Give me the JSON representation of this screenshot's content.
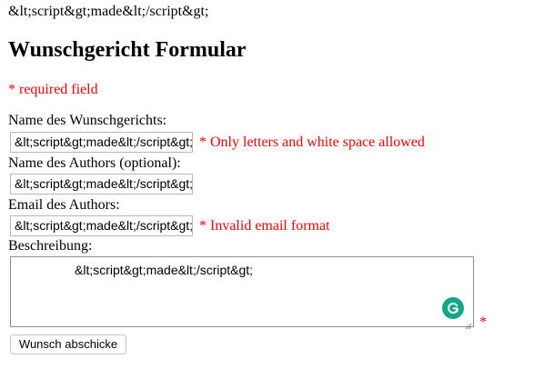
{
  "output_text": "&lt;script&gt;made&lt;/script&gt;",
  "title": "Wunschgericht Formular",
  "required_note": "* required field",
  "fields": {
    "name": {
      "label": "Name des Wunschgerichts:",
      "value": "&lt;script&gt;made&lt;/script&gt;",
      "error": "* Only letters and white space allowed"
    },
    "author": {
      "label": "Name des Authors (optional):",
      "value": "&lt;script&gt;made&lt;/script&gt;"
    },
    "email": {
      "label": "Email des Authors:",
      "value": "&lt;script&gt;made&lt;/script&gt;",
      "error": "* Invalid email format"
    },
    "description": {
      "label": "Beschreibung:",
      "value": "&lt;script&gt;made&lt;/script&gt;",
      "required_marker": "*"
    }
  },
  "submit_label": "Wunsch abschicke",
  "colors": {
    "error": "#ff0000",
    "grammarly": "#15a58a"
  },
  "icons": {
    "grammarly": "grammarly-icon",
    "resize": "resize-handle-icon"
  }
}
